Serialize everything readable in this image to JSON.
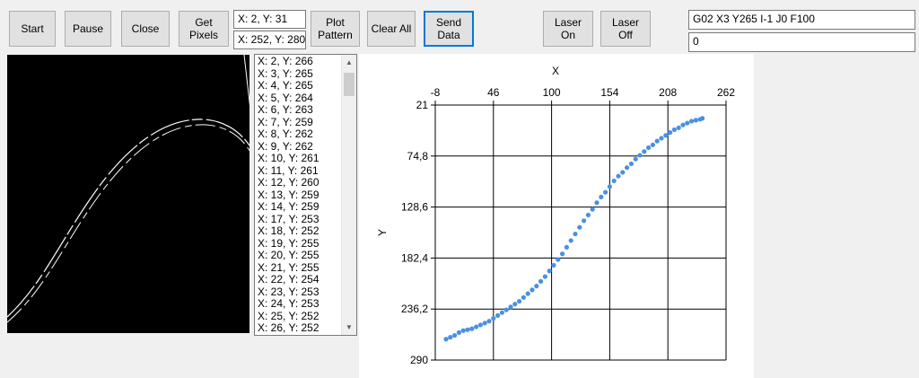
{
  "toolbar": {
    "start": "Start",
    "pause": "Pause",
    "close": "Close",
    "get_pixels": "Get\nPixels",
    "plot_pattern": "Plot\nPattern",
    "clear_all": "Clear All",
    "send_data": "Send\nData",
    "laser_on": "Laser\nOn",
    "laser_off": "Laser\nOff"
  },
  "fields": {
    "start_point": "X: 2, Y: 31",
    "end_point": "X: 252, Y: 280",
    "gcode_command": "G02 X3 Y265 I-1 J0 F100",
    "response": "0"
  },
  "coordinate_list": [
    "X: 2, Y: 266",
    "X: 3, Y: 265",
    "X: 4, Y: 265",
    "X: 5, Y: 264",
    "X: 6, Y: 263",
    "X: 7, Y: 259",
    "X: 8, Y: 262",
    "X: 9, Y: 262",
    "X: 10, Y: 261",
    "X: 11, Y: 261",
    "X: 12, Y: 260",
    "X: 13, Y: 259",
    "X: 14, Y: 259",
    "X: 17, Y: 253",
    "X: 18, Y: 252",
    "X: 19, Y: 255",
    "X: 20, Y: 255",
    "X: 21, Y: 255",
    "X: 22, Y: 254",
    "X: 23, Y: 253",
    "X: 24, Y: 253",
    "X: 25, Y: 252",
    "X: 26, Y: 252"
  ],
  "icons": {
    "scroll_up": "chevron-up-icon",
    "scroll_down": "chevron-down-icon"
  },
  "colors": {
    "series": "#4a90e2",
    "preview_background": "#000000",
    "preview_curve": "#ffffff",
    "focus_border": "#0078d7"
  },
  "chart_data": {
    "type": "scatter",
    "xlabel": "X",
    "ylabel": "Y",
    "xlim": [
      -8,
      262
    ],
    "ylim": [
      21,
      290
    ],
    "y_inverted": true,
    "x_axis_position": "top",
    "x_ticks": [
      "-8",
      "46",
      "100",
      "154",
      "208",
      "262"
    ],
    "y_ticks": [
      "21",
      "74,8",
      "128,6",
      "182,4",
      "236,2",
      "290"
    ],
    "grid": true,
    "series": [
      {
        "points": [
          [
            2,
            268
          ],
          [
            6,
            266
          ],
          [
            10,
            264
          ],
          [
            14,
            261
          ],
          [
            18,
            259
          ],
          [
            22,
            258
          ],
          [
            26,
            257
          ],
          [
            30,
            255
          ],
          [
            34,
            253
          ],
          [
            38,
            251
          ],
          [
            42,
            249
          ],
          [
            46,
            246
          ],
          [
            50,
            243
          ],
          [
            54,
            240
          ],
          [
            58,
            237
          ],
          [
            62,
            234
          ],
          [
            66,
            231
          ],
          [
            70,
            228
          ],
          [
            74,
            224
          ],
          [
            78,
            220
          ],
          [
            82,
            216
          ],
          [
            86,
            212
          ],
          [
            90,
            207
          ],
          [
            94,
            202
          ],
          [
            98,
            196
          ],
          [
            102,
            190
          ],
          [
            106,
            184
          ],
          [
            110,
            178
          ],
          [
            114,
            171
          ],
          [
            118,
            164
          ],
          [
            122,
            157
          ],
          [
            126,
            150
          ],
          [
            130,
            143
          ],
          [
            134,
            137
          ],
          [
            138,
            131
          ],
          [
            142,
            124
          ],
          [
            146,
            118
          ],
          [
            150,
            113
          ],
          [
            154,
            107
          ],
          [
            158,
            101
          ],
          [
            162,
            96
          ],
          [
            166,
            92
          ],
          [
            170,
            87
          ],
          [
            174,
            83
          ],
          [
            178,
            78
          ],
          [
            182,
            74
          ],
          [
            186,
            70
          ],
          [
            190,
            66
          ],
          [
            194,
            63
          ],
          [
            198,
            59
          ],
          [
            202,
            56
          ],
          [
            206,
            53
          ],
          [
            210,
            50
          ],
          [
            214,
            47
          ],
          [
            218,
            45
          ],
          [
            222,
            42
          ],
          [
            226,
            40
          ],
          [
            230,
            38
          ],
          [
            234,
            37
          ],
          [
            238,
            36
          ],
          [
            240,
            35
          ]
        ]
      }
    ]
  }
}
